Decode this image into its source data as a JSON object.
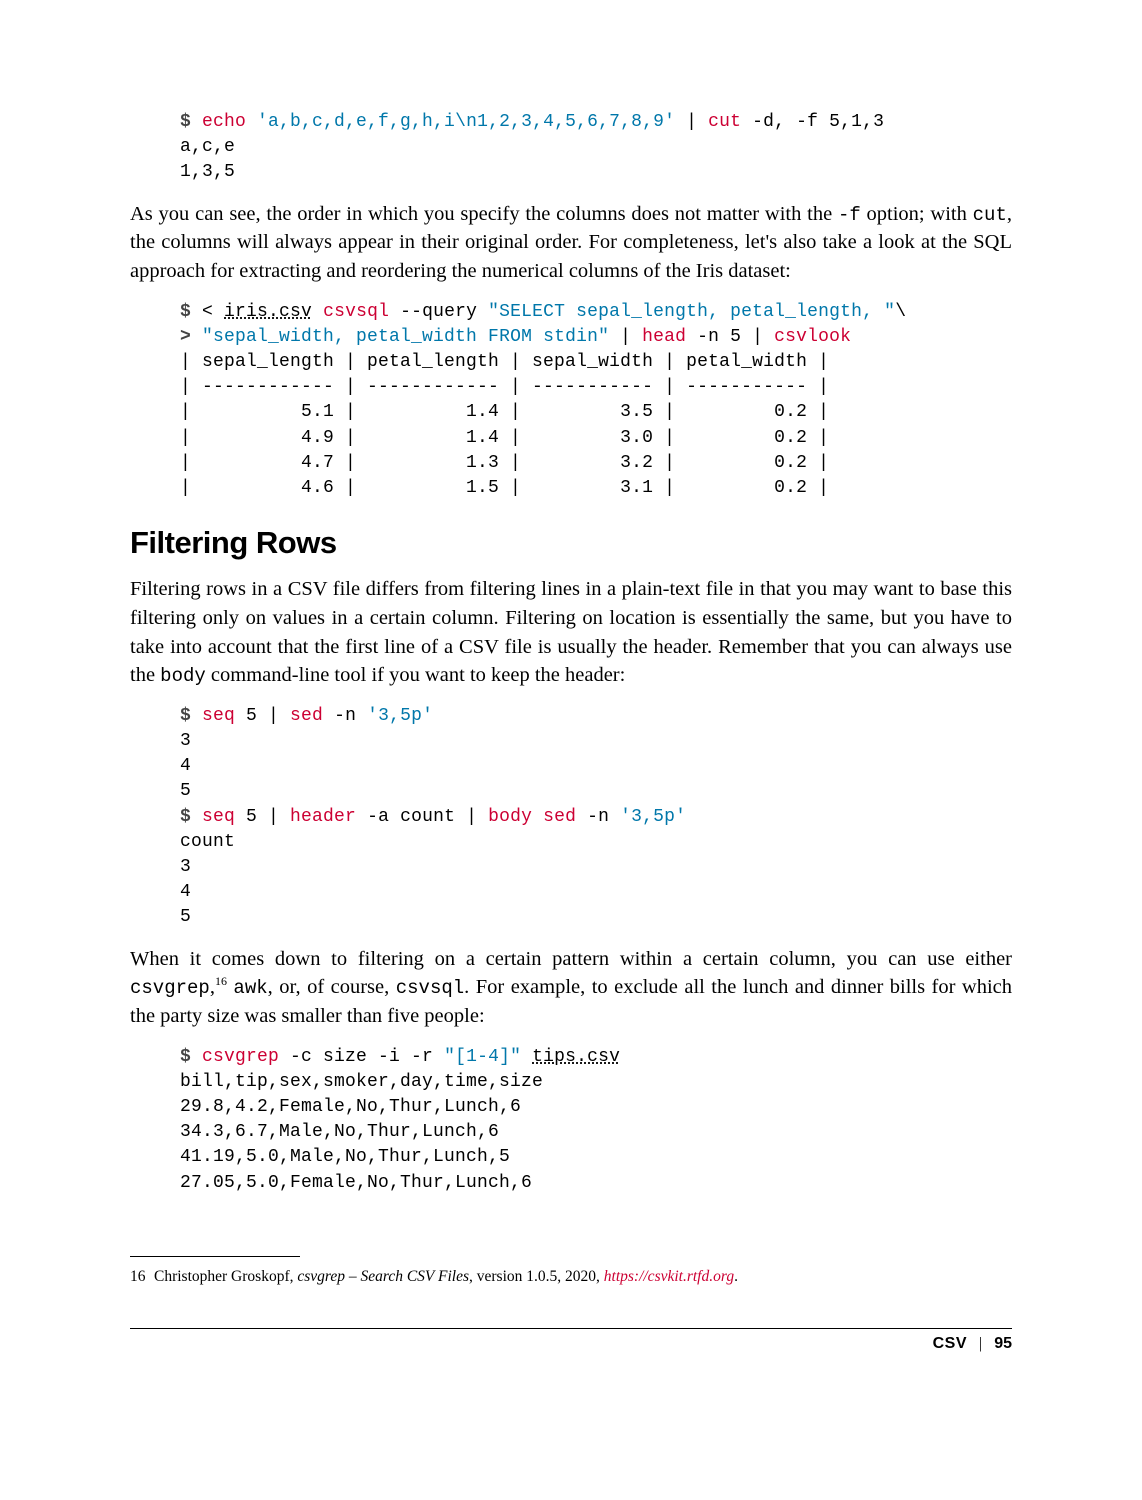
{
  "code1": {
    "line1_prompt": "$ ",
    "line1_cmd1": "echo ",
    "line1_str1": "'a,b,c,d,e,f,g,h,i\\n1,2,3,4,5,6,7,8,9'",
    "line1_mid": " | ",
    "line1_cmd2": "cut",
    "line1_args": " -d, -f 5,1,3",
    "line2": "a,c,e",
    "line3": "1,3,5"
  },
  "para1": {
    "t1": "As you can see, the order in which you specify the columns does not matter with the ",
    "m1": "-f",
    "t2": " option; with ",
    "m2": "cut",
    "t3": ", the columns will always appear in their original order. For completeness, let's also take a look at the SQL approach for extracting and reordering the numerical columns of the Iris dataset:"
  },
  "code2": {
    "l1_prompt": "$ ",
    "l1_a": "< ",
    "l1_file": "iris.csv",
    "l1_sp": " ",
    "l1_cmd": "csvsql",
    "l1_b": " --query ",
    "l1_str": "\"SELECT sepal_length, petal_length, \"",
    "l1_bs": "\\",
    "l2_prompt": "> ",
    "l2_str": "\"sepal_width, petal_width FROM stdin\"",
    "l2_mid1": " | ",
    "l2_cmd1": "head",
    "l2_args1": " -n 5 | ",
    "l2_cmd2": "csvlook",
    "l3": "| sepal_length | petal_length | sepal_width | petal_width |",
    "l4": "| ------------ | ------------ | ----------- | ----------- |",
    "l5": "|          5.1 |          1.4 |         3.5 |         0.2 |",
    "l6": "|          4.9 |          1.4 |         3.0 |         0.2 |",
    "l7": "|          4.7 |          1.3 |         3.2 |         0.2 |",
    "l8": "|          4.6 |          1.5 |         3.1 |         0.2 |"
  },
  "heading": "Filtering Rows",
  "para2": {
    "t1": "Filtering rows in a CSV file differs from filtering lines in a plain-text file in that you may want to base this filtering only on values in a certain column. Filtering on location is essentially the same, but you have to take into account that the first line of a CSV file is usually the header. Remember that you can always use the ",
    "m1": "body",
    "t2": " command-line tool if you want to keep the header:"
  },
  "code3": {
    "l1_prompt": "$ ",
    "l1_cmd1": "seq",
    "l1_a": " 5 | ",
    "l1_cmd2": "sed",
    "l1_b": " -n ",
    "l1_str": "'3,5p'",
    "l2": "3",
    "l3": "4",
    "l4": "5",
    "l5_prompt": "$ ",
    "l5_cmd1": "seq",
    "l5_a": " 5 | ",
    "l5_cmd2": "header",
    "l5_b": " -a count | ",
    "l5_cmd3": "body",
    "l5_c": " ",
    "l5_cmd4": "sed",
    "l5_d": " -n ",
    "l5_str": "'3,5p'",
    "l6": "count",
    "l7": "3",
    "l8": "4",
    "l9": "5"
  },
  "para3": {
    "t1": "When it comes down to filtering on a certain pattern within a certain column, you can use either ",
    "m1": "csvgrep",
    "t2": ",",
    "sup": "16",
    "t3": " ",
    "m2": "awk",
    "t4": ", or, of course, ",
    "m3": "csvsql",
    "t5": ". For example, to exclude all the lunch and dinner bills for which the party size was smaller than five people:"
  },
  "code4": {
    "l1_prompt": "$ ",
    "l1_cmd": "csvgrep",
    "l1_a": " -c size -i -r ",
    "l1_str": "\"[1-4]\"",
    "l1_sp": " ",
    "l1_file": "tips.csv",
    "l2": "bill,tip,sex,smoker,day,time,size",
    "l3": "29.8,4.2,Female,No,Thur,Lunch,6",
    "l4": "34.3,6.7,Male,No,Thur,Lunch,6",
    "l5": "41.19,5.0,Male,No,Thur,Lunch,5",
    "l6": "27.05,5.0,Female,No,Thur,Lunch,6"
  },
  "footnote": {
    "num": "16",
    "author": "Christopher Groskopf, ",
    "title": "csvgrep – Search CSV Files",
    "post": ", version 1.0.5, 2020, ",
    "url": "https://csvkit.rtfd.org",
    "dot": "."
  },
  "footer": {
    "chapter": "CSV",
    "page": "95"
  }
}
